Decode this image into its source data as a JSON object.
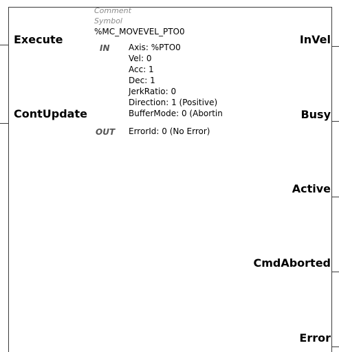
{
  "header": {
    "comment_label": "Comment",
    "symbol_label": "Symbol",
    "instance_name": "%MC_MOVEVEL_PTO0"
  },
  "inputs": [
    {
      "label": "Execute"
    },
    {
      "label": "ContUpdate"
    }
  ],
  "outputs": [
    {
      "label": "InVel"
    },
    {
      "label": "Busy"
    },
    {
      "label": "Active"
    },
    {
      "label": "CmdAborted"
    },
    {
      "label": "Error"
    }
  ],
  "params_in": {
    "section": "IN",
    "items": [
      "Axis: %PTO0",
      "Vel: 0",
      "Acc: 1",
      "Dec: 1",
      "JerkRatio: 0",
      "Direction: 1 (Positive)",
      "BufferMode: 0 (Abortin"
    ]
  },
  "params_out": {
    "section": "OUT",
    "items": [
      "ErrorId: 0 (No Error)"
    ]
  }
}
